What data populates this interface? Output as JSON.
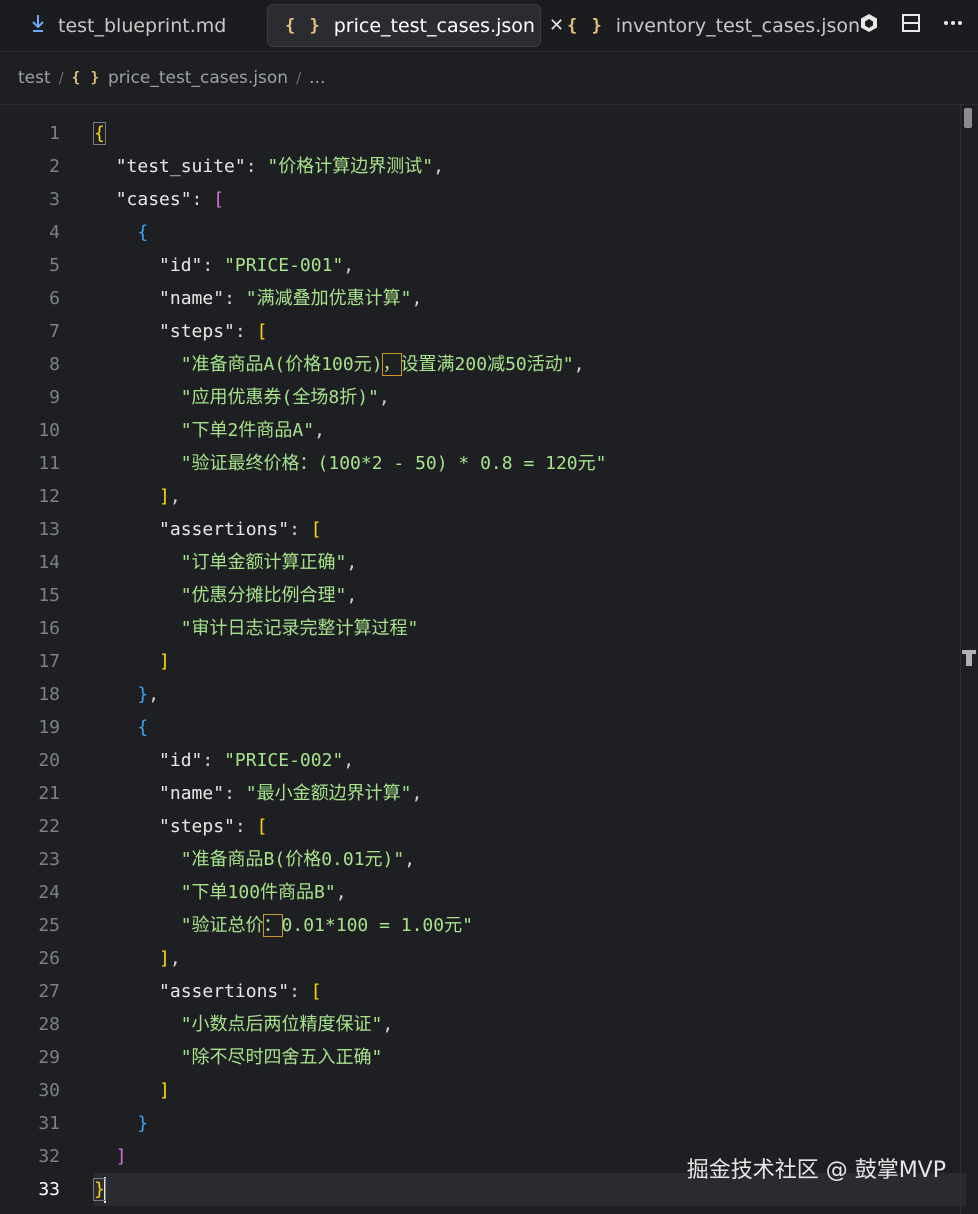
{
  "tabs": [
    {
      "label": "test_blueprint.md",
      "icon": "markdown-download-icon",
      "active": false
    },
    {
      "label": "price_test_cases.json",
      "icon": "json-braces-icon",
      "active": true
    },
    {
      "label": "inventory_test_cases.json",
      "icon": "json-braces-icon",
      "active": false
    }
  ],
  "tab_icons": {
    "json": "{ }",
    "close": "✕"
  },
  "breadcrumb": {
    "folder": "test",
    "file": "price_test_cases.json",
    "more": "..."
  },
  "line_numbers": [
    "1",
    "2",
    "3",
    "4",
    "5",
    "6",
    "7",
    "8",
    "9",
    "10",
    "11",
    "12",
    "13",
    "14",
    "15",
    "16",
    "17",
    "18",
    "19",
    "20",
    "21",
    "22",
    "23",
    "24",
    "25",
    "26",
    "27",
    "28",
    "29",
    "30",
    "31",
    "32",
    "33"
  ],
  "code": {
    "l2_key": "\"test_suite\"",
    "l2_val": "\"价格计算边界测试\"",
    "l3_key": "\"cases\"",
    "l5_key": "\"id\"",
    "l5_val": "\"PRICE-001\"",
    "l6_key": "\"name\"",
    "l6_val": "\"满减叠加优惠计算\"",
    "l7_key": "\"steps\"",
    "l8_a": "\"准备商品A(价格100元)",
    "l8_b": "，",
    "l8_c": "设置满200减50活动\"",
    "l9_val": "\"应用优惠券(全场8折)\"",
    "l10_val": "\"下单2件商品A\"",
    "l11_val": "\"验证最终价格：(100*2 - 50) * 0.8 = 120元\"",
    "l13_key": "\"assertions\"",
    "l14_val": "\"订单金额计算正确\"",
    "l15_val": "\"优惠分摊比例合理\"",
    "l16_val": "\"审计日志记录完整计算过程\"",
    "l20_key": "\"id\"",
    "l20_val": "\"PRICE-002\"",
    "l21_key": "\"name\"",
    "l21_val": "\"最小金额边界计算\"",
    "l22_key": "\"steps\"",
    "l23_val": "\"准备商品B(价格0.01元)\"",
    "l24_val": "\"下单100件商品B\"",
    "l25_a": "\"验证总价",
    "l25_b": "：",
    "l25_c": "0.01*100 = 1.00元\"",
    "l27_key": "\"assertions\"",
    "l28_val": "\"小数点后两位精度保证\"",
    "l29_val": "\"除不尽时四舍五入正确\""
  },
  "current_line": "33",
  "watermark": "掘金技术社区 @ 鼓掌MVP",
  "colors": {
    "background": "#1e1f23",
    "string": "#a6e28a",
    "bracket_gold": "#ffd700",
    "bracket_purple": "#da70d6",
    "bracket_blue": "#3da5f4"
  }
}
